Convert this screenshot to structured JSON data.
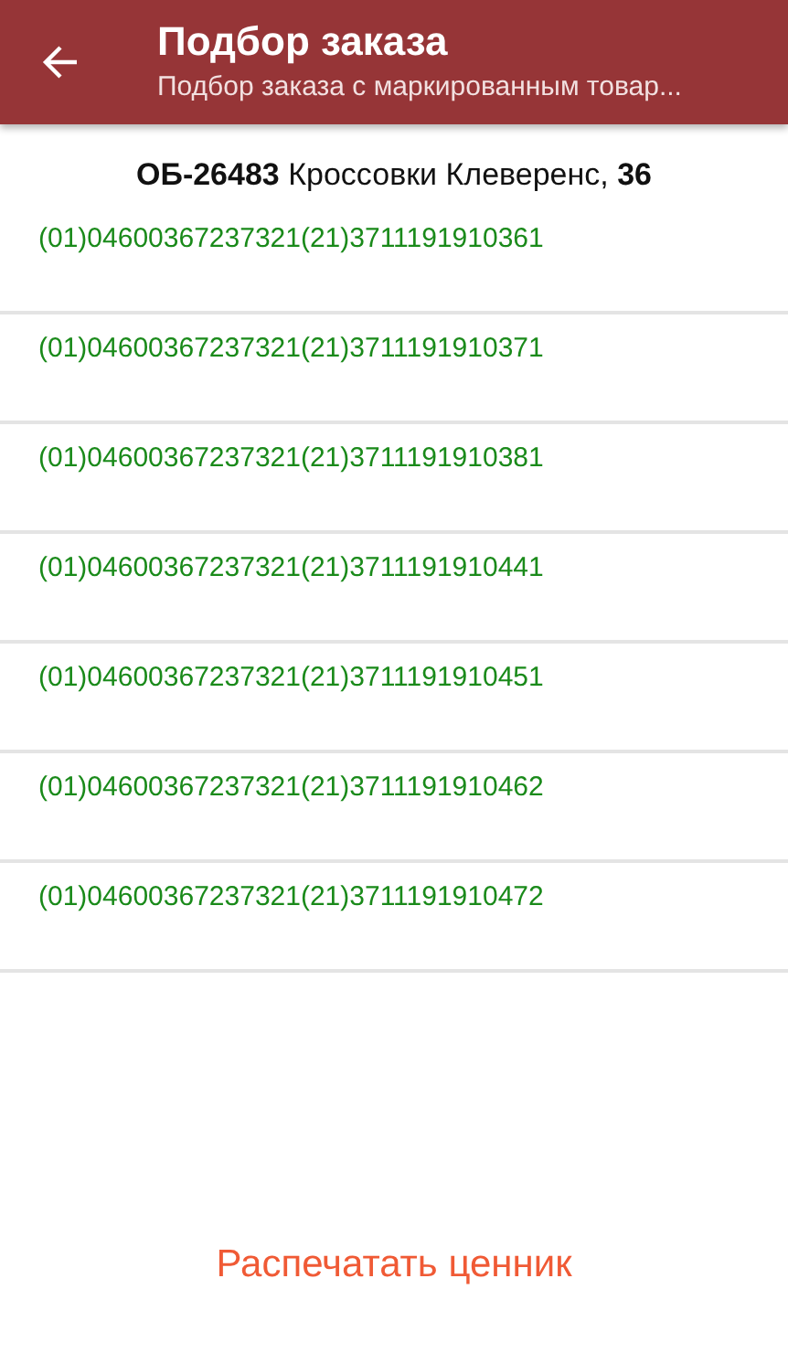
{
  "app_bar": {
    "title": "Подбор заказа",
    "subtitle": "Подбор заказа с маркированным товар..."
  },
  "product": {
    "heading": "**ОБ-26483** Кроссовки Клеверенс, **36**"
  },
  "codes": [
    "(01)04600367237321(21)3711191910361",
    "(01)04600367237321(21)3711191910371",
    "(01)04600367237321(21)3711191910381",
    "(01)04600367237321(21)3711191910441",
    "(01)04600367237321(21)3711191910451",
    "(01)04600367237321(21)3711191910462",
    "(01)04600367237321(21)3711191910472"
  ],
  "action_button": "Распечатать ценник"
}
